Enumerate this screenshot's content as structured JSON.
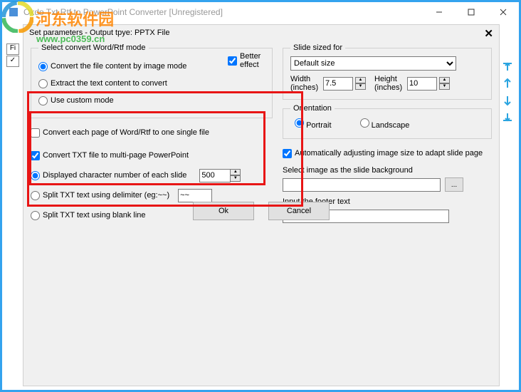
{
  "window": {
    "title": "Okdo Txt Rtf to PowerPoint Converter [Unregistered]"
  },
  "watermark": {
    "site_name": "河东软件园",
    "url": "www.pc0359.cn"
  },
  "left_strip": {
    "item1": "Fi",
    "item2": "✓"
  },
  "dialog": {
    "title": "Set parameters - Output tpye: PPTX File",
    "convert_mode_legend": "Select convert Word/Rtf mode",
    "mode_image": "Convert the file content by image mode",
    "better_effect": "Better effect",
    "mode_text": "Extract the text content to convert",
    "mode_custom": "Use custom mode",
    "each_page_single": "Convert each page of Word/Rtf to one single file",
    "txt_multi": "Convert TXT file to multi-page PowerPoint",
    "char_num": "Displayed character number of each slide",
    "char_num_val": "500",
    "split_delim": "Split TXT text using delimiter (eg:~~)",
    "delim_val": "~~",
    "split_blank": "Split TXT text using blank line",
    "slide_size_legend": "Slide sized for",
    "slide_size_val": "Default size",
    "width_label": "Width (inches)",
    "width_val": "7.5",
    "height_label": "Height (inches)",
    "height_val": "10",
    "orientation_legend": "Orientation",
    "portrait": "Portrait",
    "landscape": "Landscape",
    "auto_adjust": "Automatically adjusting image size to adapt slide page",
    "select_bg": "Select image as the slide background",
    "browse": "...",
    "footer_text": "Input the footer text",
    "ok": "Ok",
    "cancel": "Cancel"
  }
}
